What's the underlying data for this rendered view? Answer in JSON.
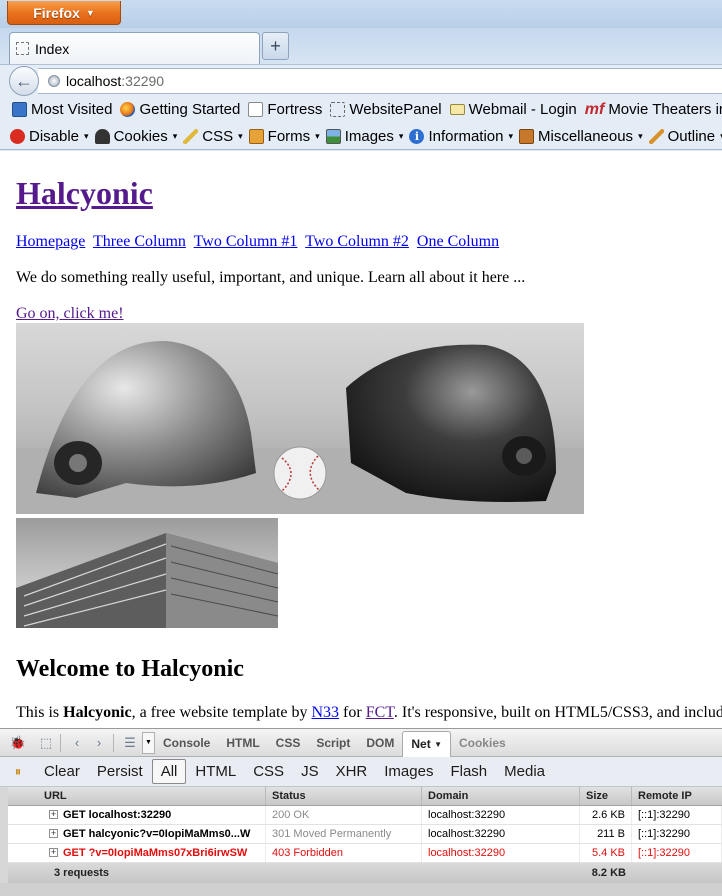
{
  "browser": {
    "menu_button": "Firefox",
    "tab_title": "Index",
    "url_host": "localhost",
    "url_port": ":32290",
    "new_tab": "+"
  },
  "bookmarks": [
    {
      "label": "Most Visited",
      "icon": "most-visited-icon"
    },
    {
      "label": "Getting Started",
      "icon": "firefox-icon"
    },
    {
      "label": "Fortress",
      "icon": "page-icon"
    },
    {
      "label": "WebsitePanel",
      "icon": "blank-page-icon"
    },
    {
      "label": "Webmail - Login",
      "icon": "mail-icon"
    },
    {
      "label": "Movie Theaters in",
      "icon": "mf-icon"
    }
  ],
  "webdev_toolbar": [
    {
      "label": "Disable",
      "icon": "disable-icon"
    },
    {
      "label": "Cookies",
      "icon": "cookies-icon"
    },
    {
      "label": "CSS",
      "icon": "css-icon"
    },
    {
      "label": "Forms",
      "icon": "forms-icon"
    },
    {
      "label": "Images",
      "icon": "images-icon"
    },
    {
      "label": "Information",
      "icon": "information-icon"
    },
    {
      "label": "Miscellaneous",
      "icon": "miscellaneous-icon"
    },
    {
      "label": "Outline",
      "icon": "outline-icon"
    }
  ],
  "page": {
    "site_title": "Halcyonic",
    "nav": [
      "Homepage",
      "Three Column",
      "Two Column #1",
      "Two Column #2",
      "One Column"
    ],
    "tagline": "We do something really useful, important, and unique. Learn all about it here ...",
    "cta": "Go on, click me!",
    "welcome_heading": "Welcome to Halcyonic",
    "intro_prefix": "This is ",
    "intro_bold": "Halcyonic",
    "intro_mid": ", a free website template by ",
    "intro_link1": "N33",
    "intro_for": " for ",
    "intro_link2": "FCT",
    "intro_suffix": ". It's responsive, built on HTML5/CSS3, and includ"
  },
  "firebug": {
    "panels": [
      "Console",
      "HTML",
      "CSS",
      "Script",
      "DOM",
      "Net",
      "Cookies"
    ],
    "active_panel": "Net",
    "filters": [
      "Clear",
      "Persist",
      "All",
      "HTML",
      "CSS",
      "JS",
      "XHR",
      "Images",
      "Flash",
      "Media"
    ],
    "active_filter": "All",
    "columns": {
      "url": "URL",
      "status": "Status",
      "domain": "Domain",
      "size": "Size",
      "ip": "Remote IP"
    },
    "requests": [
      {
        "url": "GET localhost:32290",
        "status": "200 OK",
        "domain": "localhost:32290",
        "size": "2.6 KB",
        "ip": "[::1]:32290",
        "error": false
      },
      {
        "url": "GET halcyonic?v=0IopiMaMms0...W",
        "status": "301 Moved Permanently",
        "domain": "localhost:32290",
        "size": "211 B",
        "ip": "[::1]:32290",
        "error": false
      },
      {
        "url": "GET ?v=0IopiMaMms07xBri6irwSW",
        "status": "403 Forbidden",
        "domain": "localhost:32290",
        "size": "5.4 KB",
        "ip": "[::1]:32290",
        "error": true
      }
    ],
    "summary_count": "3 requests",
    "summary_size": "8.2 KB",
    "error_color": "#e40d0d"
  }
}
